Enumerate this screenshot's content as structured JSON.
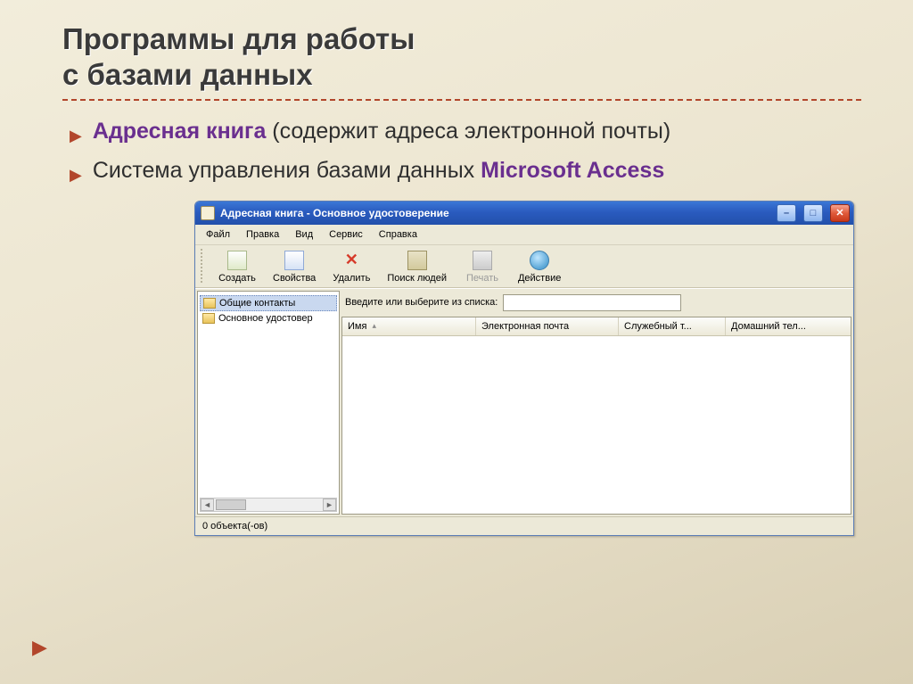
{
  "slide": {
    "title_line1": "Программы для работы",
    "title_line2": "с базами данных",
    "bullets": [
      {
        "highlight": "Адресная книга",
        "rest": " (содержит адреса электронной почты)"
      },
      {
        "plain": "Система управления базами данных ",
        "highlight2": "Microsoft Access"
      }
    ]
  },
  "window": {
    "title": "Адресная книга - Основное удостоверение",
    "menus": [
      "Файл",
      "Правка",
      "Вид",
      "Сервис",
      "Справка"
    ],
    "toolbar": {
      "create": "Создать",
      "properties": "Свойства",
      "delete": "Удалить",
      "find": "Поиск людей",
      "print": "Печать",
      "action": "Действие"
    },
    "tree": {
      "items": [
        "Общие контакты",
        "Основное удостовер"
      ]
    },
    "filter_label": "Введите или выберите из списка:",
    "filter_value": "",
    "columns": [
      "Имя",
      "Электронная почта",
      "Служебный т...",
      "Домашний тел..."
    ],
    "status": "0 объекта(-ов)"
  },
  "controls": {
    "minimize_glyph": "–",
    "maximize_glyph": "□",
    "close_glyph": "✕",
    "scroll_left": "◄",
    "scroll_right": "►",
    "delete_glyph": "✕"
  }
}
